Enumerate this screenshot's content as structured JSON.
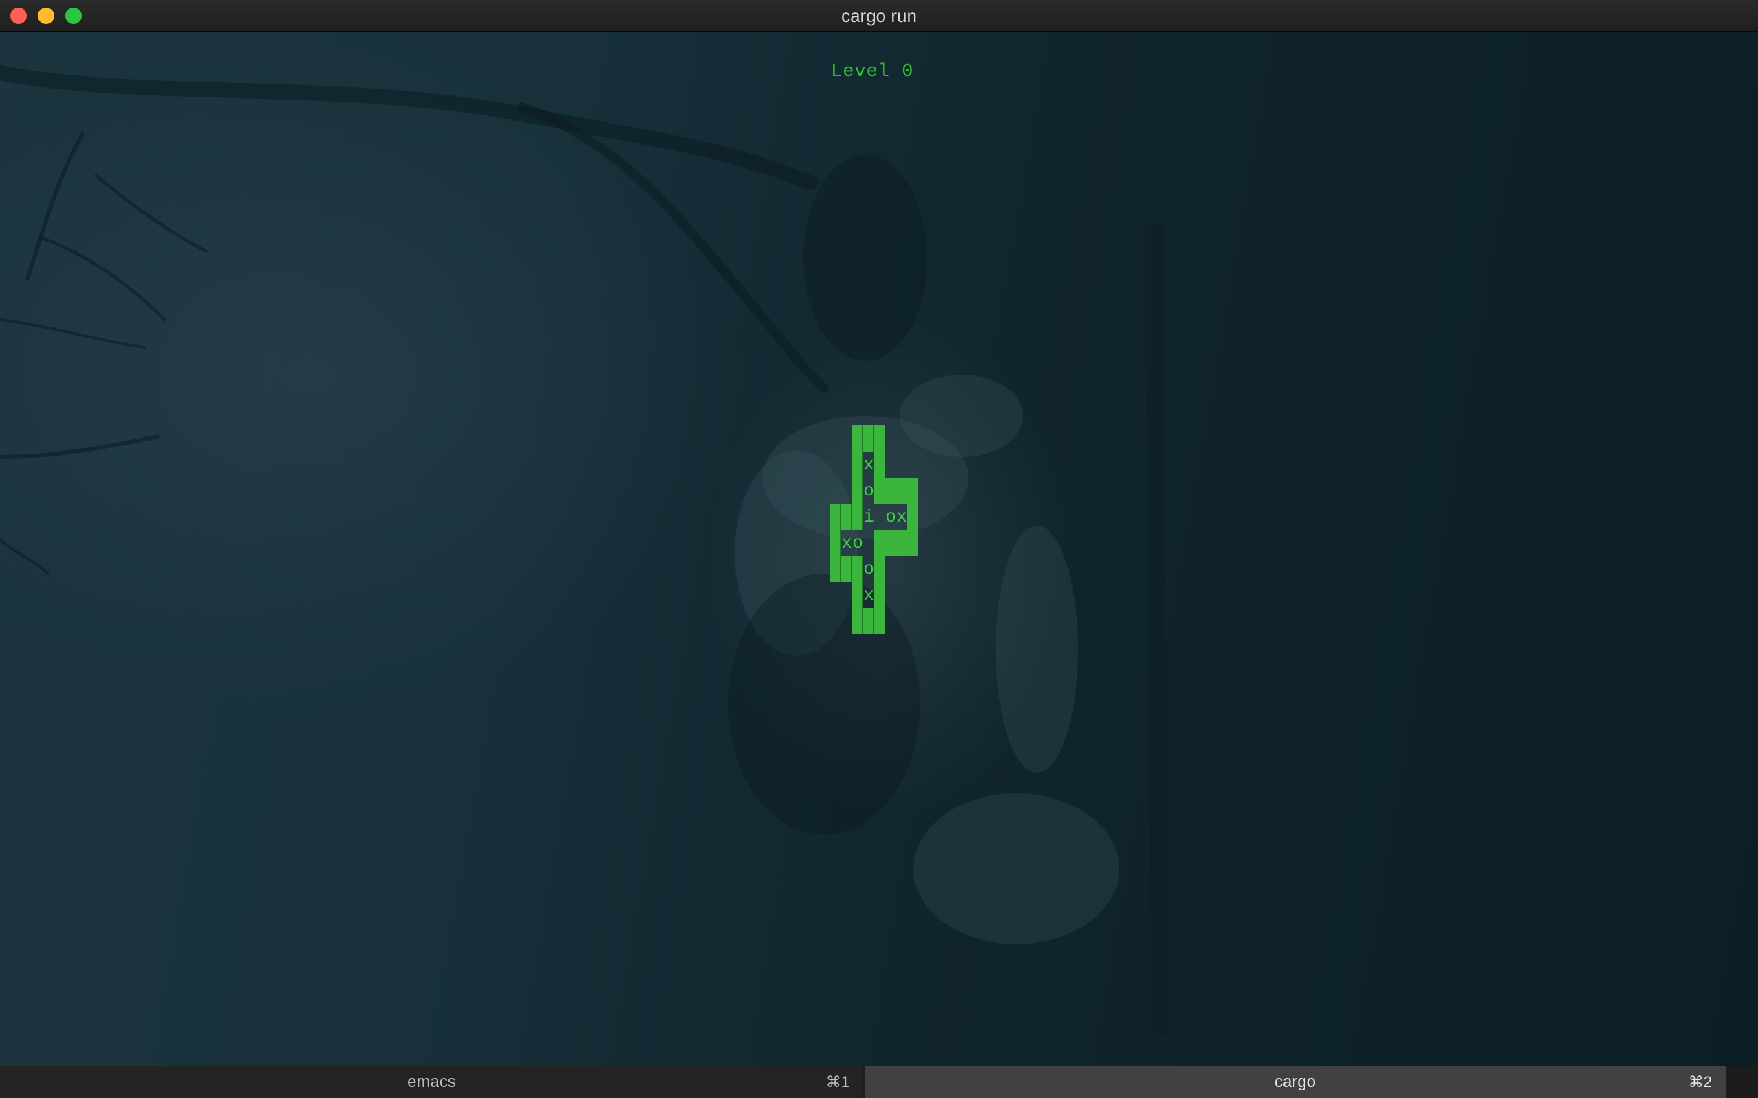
{
  "window": {
    "title": "cargo run"
  },
  "game": {
    "level_label": "Level 0",
    "board": {
      "cols": 8,
      "rows": 8,
      "cells": [
        [
          "",
          "",
          "#",
          "#",
          "#",
          "",
          "",
          ""
        ],
        [
          "",
          "",
          "#",
          "x",
          "#",
          "",
          "",
          ""
        ],
        [
          "",
          "",
          "#",
          "o",
          "#",
          "#",
          "#",
          "#"
        ],
        [
          "#",
          "#",
          "#",
          "i",
          " ",
          "o",
          "x",
          "#"
        ],
        [
          "#",
          "x",
          "o",
          " ",
          "#",
          "#",
          "#",
          "#"
        ],
        [
          "#",
          "#",
          "#",
          "o",
          "#",
          "",
          "",
          ""
        ],
        [
          "",
          "",
          "#",
          "x",
          "#",
          "",
          "",
          ""
        ],
        [
          "",
          "",
          "#",
          "#",
          "#",
          "",
          "",
          ""
        ]
      ]
    }
  },
  "tabs": [
    {
      "label": "emacs",
      "shortcut": "⌘1",
      "active": false
    },
    {
      "label": "cargo",
      "shortcut": "⌘2",
      "active": true
    }
  ],
  "colors": {
    "accent_green": "#3fd03f",
    "close": "#fe5f57",
    "minimize": "#febc2e",
    "maximize": "#28c840"
  }
}
